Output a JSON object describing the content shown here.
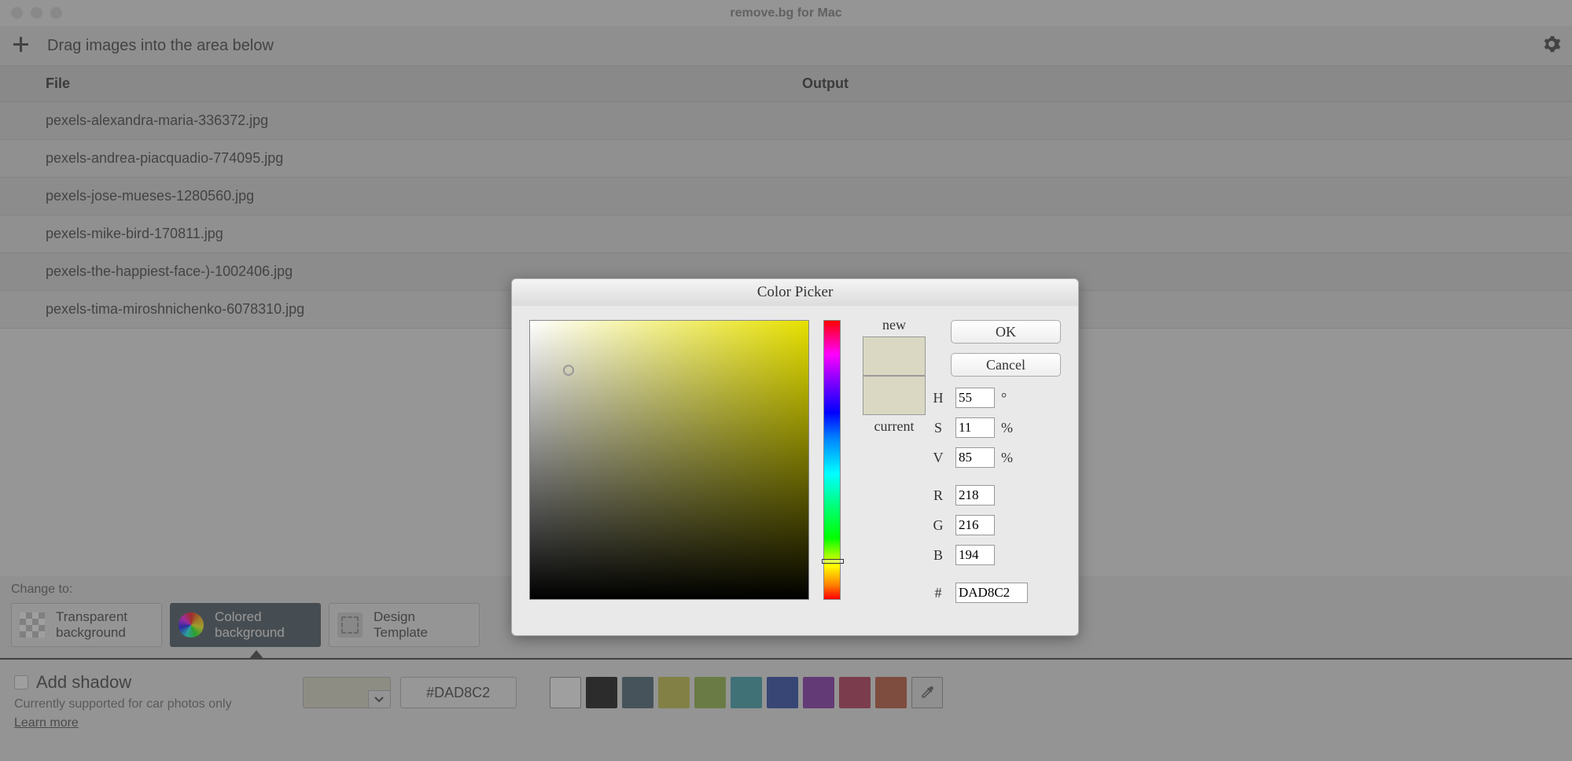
{
  "window": {
    "title": "remove.bg for Mac"
  },
  "toolbar": {
    "drag_label": "Drag images into the area below"
  },
  "columns": {
    "file": "File",
    "output": "Output"
  },
  "files": [
    "pexels-alexandra-maria-336372.jpg",
    "pexels-andrea-piacquadio-774095.jpg",
    "pexels-jose-mueses-1280560.jpg",
    "pexels-mike-bird-170811.jpg",
    "pexels-the-happiest-face-)-1002406.jpg",
    "pexels-tima-miroshnichenko-6078310.jpg"
  ],
  "change_to": {
    "label": "Change to:",
    "options": {
      "transparent": {
        "line1": "Transparent",
        "line2": "background"
      },
      "colored": {
        "line1": "Colored",
        "line2": "background"
      },
      "template": {
        "line1": "Design",
        "line2": "Template"
      }
    },
    "active": "colored"
  },
  "shadow": {
    "title": "Add shadow",
    "sub": "Currently supported for car photos only",
    "link": "Learn more"
  },
  "color_bar": {
    "selected_hex": "#DAD8C2",
    "swatches": [
      "#ffffff",
      "#000000",
      "#3d5866",
      "#c0bb3a",
      "#8db03a",
      "#2e99a6",
      "#1c3aa3",
      "#7a1fa3",
      "#b0264c",
      "#b54a2a"
    ]
  },
  "picker": {
    "title": "Color Picker",
    "new_label": "new",
    "current_label": "current",
    "new_color": "#DAD8C2",
    "current_color": "#DAD8C2",
    "ok": "OK",
    "cancel": "Cancel",
    "H": "55",
    "H_unit": "°",
    "S": "11",
    "S_unit": "%",
    "V": "85",
    "V_unit": "%",
    "R": "218",
    "G": "216",
    "B": "194",
    "hex_label": "#",
    "hex": "DAD8C2"
  }
}
